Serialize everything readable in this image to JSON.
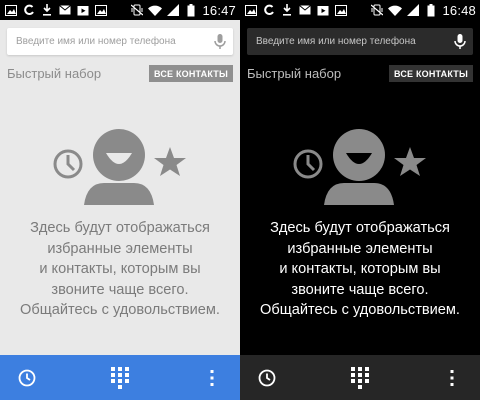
{
  "screens": [
    {
      "theme": "light",
      "status": {
        "time": "16:47"
      },
      "search": {
        "placeholder": "Введите имя или номер телефона",
        "icon": "mic-icon"
      },
      "speed_dial": {
        "label": "Быстрый набор",
        "all_contacts": "ВСЕ КОНТАКТЫ"
      },
      "empty_state": {
        "lines": [
          "Здесь будут отображаться",
          "избранные элементы",
          "и контакты, которым вы",
          "звоните чаще всего.",
          "Общайтесь с удовольствием."
        ]
      },
      "bottom_bar": {
        "left_icon": "recent-calls-icon",
        "center_icon": "dialpad-icon",
        "right_icon": "overflow-menu-icon"
      },
      "colors": {
        "accent": "#3d7fe0",
        "background": "#e9e9e9",
        "illustration": "#8a8a8a"
      }
    },
    {
      "theme": "dark",
      "status": {
        "time": "16:48"
      },
      "search": {
        "placeholder": "Введите имя или номер телефона",
        "icon": "mic-icon"
      },
      "speed_dial": {
        "label": "Быстрый набор",
        "all_contacts": "ВСЕ КОНТАКТЫ"
      },
      "empty_state": {
        "lines": [
          "Здесь будут отображаться",
          "избранные элементы",
          "и контакты, которым вы",
          "звоните чаще всего.",
          "Общайтесь с удовольствием."
        ]
      },
      "bottom_bar": {
        "left_icon": "recent-calls-icon",
        "center_icon": "dialpad-icon",
        "right_icon": "overflow-menu-icon"
      },
      "colors": {
        "accent": "#262626",
        "background": "#000000",
        "illustration": "#8a8a8a"
      }
    }
  ]
}
